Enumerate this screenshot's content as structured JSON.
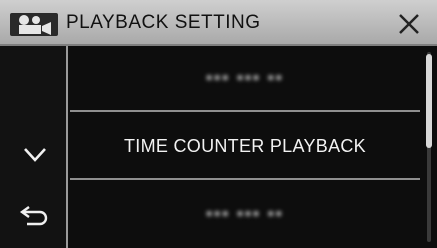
{
  "header": {
    "title": "PLAYBACK SETTING",
    "mode_icon": "video-camera-icon",
    "close_icon": "close-icon"
  },
  "sidebar": {
    "down_icon": "chevron-down-icon",
    "back_icon": "back-arrow-icon"
  },
  "menu": {
    "items": [
      {
        "label": "▪▪▪ ▪▪▪ ▪▪",
        "obscured": true
      },
      {
        "label": "TIME COUNTER PLAYBACK",
        "obscured": false
      },
      {
        "label": "▪▪▪ ▪▪▪ ▪▪",
        "obscured": true
      }
    ]
  },
  "scroll": {
    "position": 0.0,
    "visible_fraction": 0.5
  },
  "colors": {
    "header_bg": "#bdbdbd",
    "screen_bg": "#0d0d0d",
    "divider": "#8f8f8f",
    "text": "#f2f2f2"
  }
}
